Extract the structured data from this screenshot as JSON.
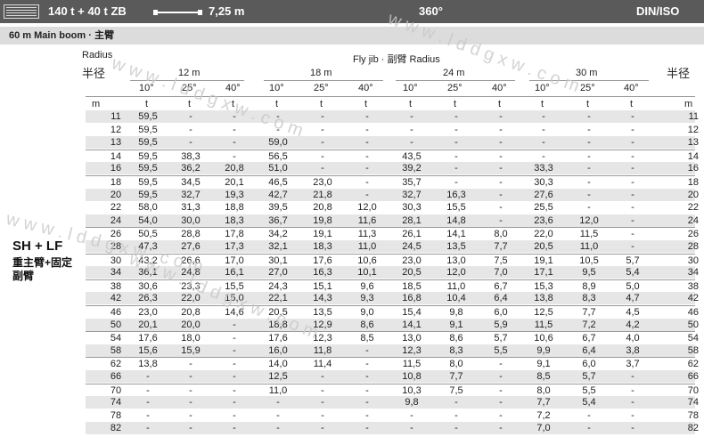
{
  "header": {
    "config": "140 t + 40 t ZB",
    "boom_length": "7,25 m",
    "slew": "360°",
    "standard": "DIN/ISO"
  },
  "subheader": {
    "label": "60 m  Main boom · 主臂"
  },
  "table": {
    "radius_en": "Radius",
    "radius_cn": "半径",
    "fly_jib_label": "Fly jib · 副臂 Radius",
    "radius_cn_right": "半径",
    "jib_lengths": [
      "12 m",
      "18 m",
      "24 m",
      "30 m"
    ],
    "angles": [
      "10°",
      "25°",
      "40°",
      "10°",
      "25°",
      "40°",
      "10°",
      "25°",
      "40°",
      "10°",
      "25°",
      "40°"
    ],
    "unit_left": "m",
    "unit_mark": "t",
    "unit_right": "m",
    "rows": [
      {
        "r": "11",
        "v": [
          "59,5",
          "-",
          "-",
          "-",
          "-",
          "-",
          "-",
          "-",
          "-",
          "-",
          "-",
          "-"
        ]
      },
      {
        "r": "12",
        "v": [
          "59,5",
          "-",
          "-",
          "-",
          "-",
          "-",
          "-",
          "-",
          "-",
          "-",
          "-",
          "-"
        ]
      },
      {
        "r": "13",
        "v": [
          "59,5",
          "-",
          "-",
          "59,0",
          "-",
          "-",
          "-",
          "-",
          "-",
          "-",
          "-",
          "-"
        ]
      },
      {
        "r": "14",
        "v": [
          "59,5",
          "38,3",
          "-",
          "56,5",
          "-",
          "-",
          "43,5",
          "-",
          "-",
          "-",
          "-",
          "-"
        ]
      },
      {
        "r": "16",
        "v": [
          "59,5",
          "36,2",
          "20,8",
          "51,0",
          "-",
          "-",
          "39,2",
          "-",
          "-",
          "33,3",
          "-",
          "-"
        ]
      },
      {
        "r": "18",
        "v": [
          "59,5",
          "34,5",
          "20,1",
          "46,5",
          "23,0",
          "-",
          "35,7",
          "-",
          "-",
          "30,3",
          "-",
          "-"
        ]
      },
      {
        "r": "20",
        "v": [
          "59,5",
          "32,7",
          "19,3",
          "42,7",
          "21,8",
          "-",
          "32,7",
          "16,3",
          "-",
          "27,6",
          "-",
          "-"
        ]
      },
      {
        "r": "22",
        "v": [
          "58,0",
          "31,3",
          "18,8",
          "39,5",
          "20,8",
          "12,0",
          "30,3",
          "15,5",
          "-",
          "25,5",
          "-",
          "-"
        ]
      },
      {
        "r": "24",
        "v": [
          "54,0",
          "30,0",
          "18,3",
          "36,7",
          "19,8",
          "11,6",
          "28,1",
          "14,8",
          "-",
          "23,6",
          "12,0",
          "-"
        ]
      },
      {
        "r": "26",
        "v": [
          "50,5",
          "28,8",
          "17,8",
          "34,2",
          "19,1",
          "11,3",
          "26,1",
          "14,1",
          "8,0",
          "22,0",
          "11,5",
          "-"
        ]
      },
      {
        "r": "28",
        "v": [
          "47,3",
          "27,6",
          "17,3",
          "32,1",
          "18,3",
          "11,0",
          "24,5",
          "13,5",
          "7,7",
          "20,5",
          "11,0",
          "-"
        ]
      },
      {
        "r": "30",
        "v": [
          "43,2",
          "26,6",
          "17,0",
          "30,1",
          "17,6",
          "10,6",
          "23,0",
          "13,0",
          "7,5",
          "19,1",
          "10,5",
          "5,7"
        ]
      },
      {
        "r": "34",
        "v": [
          "36,1",
          "24,8",
          "16,1",
          "27,0",
          "16,3",
          "10,1",
          "20,5",
          "12,0",
          "7,0",
          "17,1",
          "9,5",
          "5,4"
        ]
      },
      {
        "r": "38",
        "v": [
          "30,6",
          "23,3",
          "15,5",
          "24,3",
          "15,1",
          "9,6",
          "18,5",
          "11,0",
          "6,7",
          "15,3",
          "8,9",
          "5,0"
        ]
      },
      {
        "r": "42",
        "v": [
          "26,3",
          "22,0",
          "15,0",
          "22,1",
          "14,3",
          "9,3",
          "16,8",
          "10,4",
          "6,4",
          "13,8",
          "8,3",
          "4,7"
        ]
      },
      {
        "r": "46",
        "v": [
          "23,0",
          "20,8",
          "14,6",
          "20,5",
          "13,5",
          "9,0",
          "15,4",
          "9,8",
          "6,0",
          "12,5",
          "7,7",
          "4,5"
        ]
      },
      {
        "r": "50",
        "v": [
          "20,1",
          "20,0",
          "-",
          "18,8",
          "12,9",
          "8,6",
          "14,1",
          "9,1",
          "5,9",
          "11,5",
          "7,2",
          "4,2"
        ]
      },
      {
        "r": "54",
        "v": [
          "17,6",
          "18,0",
          "-",
          "17,6",
          "12,3",
          "8,5",
          "13,0",
          "8,6",
          "5,7",
          "10,6",
          "6,7",
          "4,0"
        ]
      },
      {
        "r": "58",
        "v": [
          "15,6",
          "15,9",
          "-",
          "16,0",
          "11,8",
          "-",
          "12,3",
          "8,3",
          "5,5",
          "9,9",
          "6,4",
          "3,8"
        ]
      },
      {
        "r": "62",
        "v": [
          "13,8",
          "-",
          "-",
          "14,0",
          "11,4",
          "-",
          "11,5",
          "8,0",
          "-",
          "9,1",
          "6,0",
          "3,7"
        ]
      },
      {
        "r": "66",
        "v": [
          "-",
          "-",
          "-",
          "12,5",
          "-",
          "-",
          "10,8",
          "7,7",
          "-",
          "8,5",
          "5,7",
          "-"
        ]
      },
      {
        "r": "70",
        "v": [
          "-",
          "-",
          "-",
          "11,0",
          "-",
          "-",
          "10,3",
          "7,5",
          "-",
          "8,0",
          "5,5",
          "-"
        ]
      },
      {
        "r": "74",
        "v": [
          "-",
          "-",
          "-",
          "-",
          "-",
          "-",
          "9,8",
          "-",
          "-",
          "7,7",
          "5,4",
          "-"
        ]
      },
      {
        "r": "78",
        "v": [
          "-",
          "-",
          "-",
          "-",
          "-",
          "-",
          "-",
          "-",
          "-",
          "7,2",
          "-",
          "-"
        ]
      },
      {
        "r": "82",
        "v": [
          "-",
          "-",
          "-",
          "-",
          "-",
          "-",
          "-",
          "-",
          "-",
          "7,0",
          "-",
          "-"
        ]
      }
    ]
  },
  "side_label": {
    "line1": "SH + LF",
    "line2": "重主臂+固定",
    "line3": "副臂"
  },
  "watermarks": [
    "w w w . l d d g x w . c o m",
    "w w w . l d d g x w . c o m",
    "w w w . l d d g x w . c o m",
    "w w w . l d d g x w . c o m"
  ]
}
